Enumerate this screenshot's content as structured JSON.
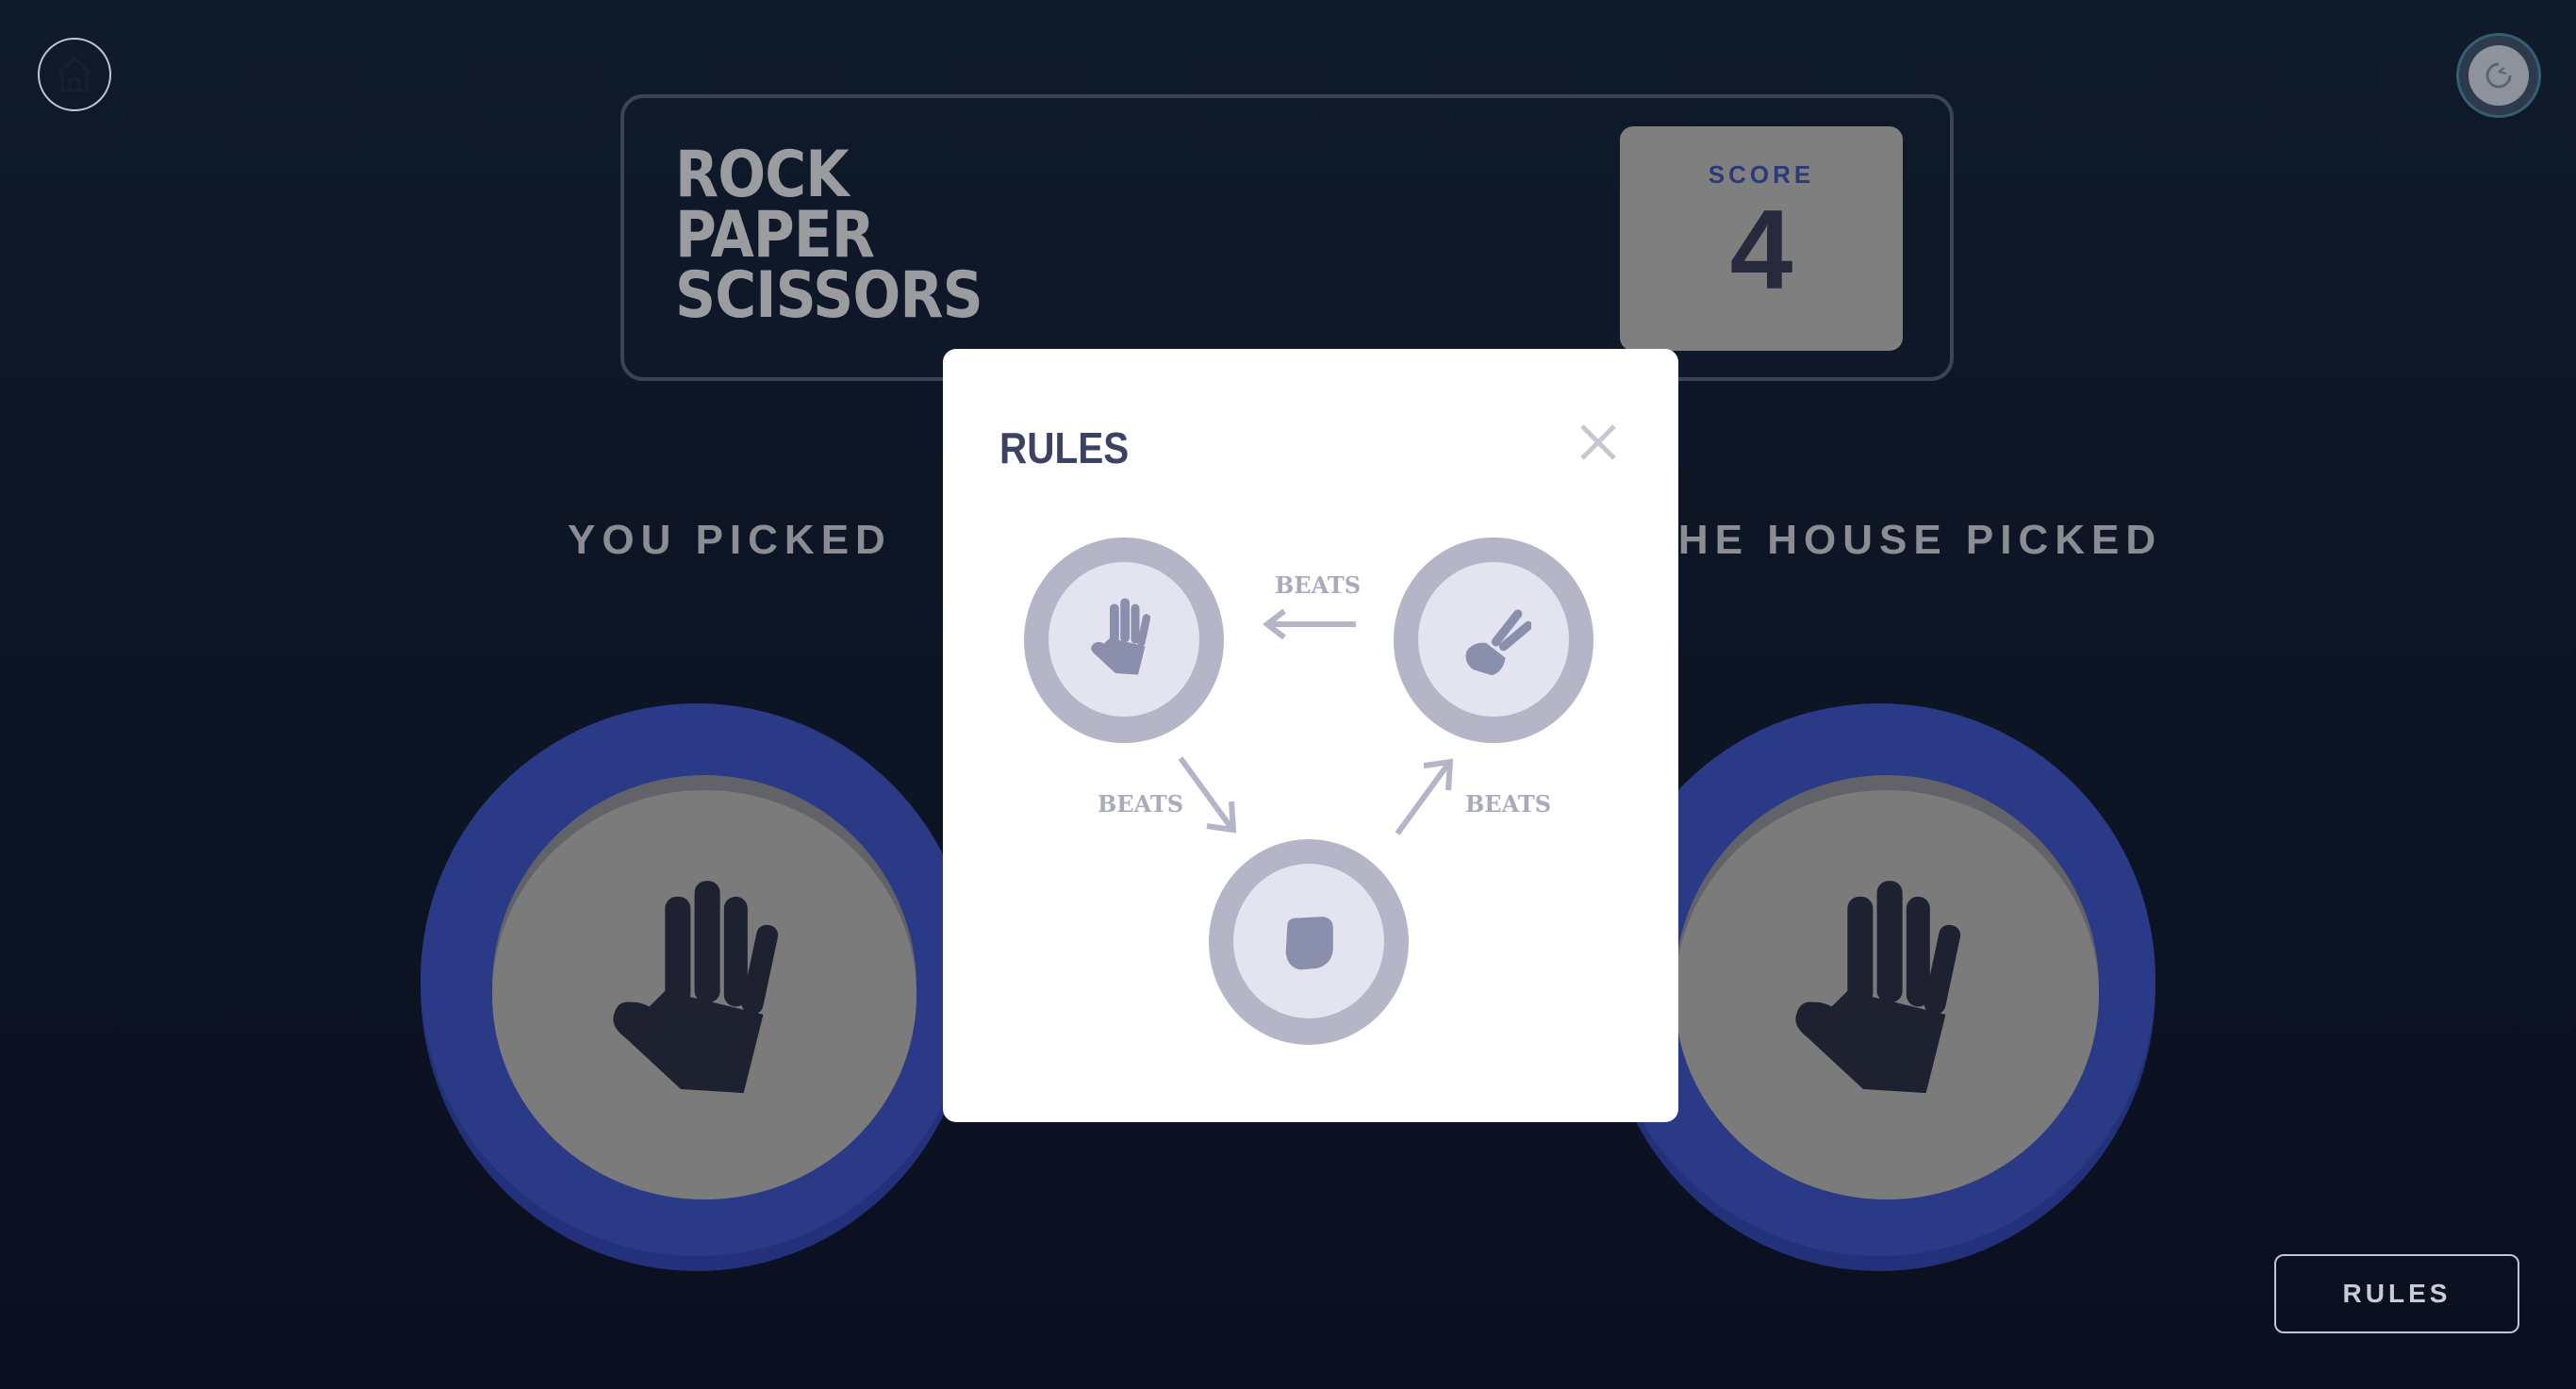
{
  "header": {
    "title_lines": [
      "ROCK",
      "PAPER",
      "SCISSORS"
    ],
    "score_label": "SCORE",
    "score_value": "4"
  },
  "icons": {
    "home": "home-icon",
    "theme": "theme-toggle-icon",
    "close": "close-icon",
    "paper": "paper-hand-icon",
    "scissors": "scissors-hand-icon",
    "rock": "rock-fist-icon",
    "arrow": "arrow-icon"
  },
  "game": {
    "you_picked_label": "YOU PICKED",
    "house_picked_label": "THE HOUSE PICKED",
    "you_choice": "paper",
    "house_choice": "paper"
  },
  "rules_button": {
    "label": "RULES"
  },
  "modal": {
    "title": "RULES",
    "beats_label": "BEATS"
  },
  "colors": {
    "background": "#0f1a2a",
    "chip_ring": "#2b3a86",
    "chip_face": "#7b7b7b",
    "score_box": "#7f7f7f",
    "modal_bg": "#ffffff"
  }
}
